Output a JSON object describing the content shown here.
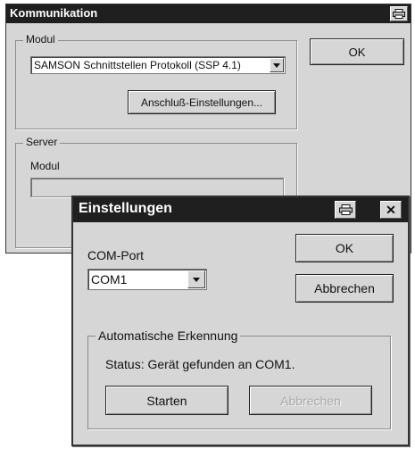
{
  "main_window": {
    "title": "Kommunikation",
    "icon": "printer-icon",
    "ok_label": "OK",
    "modul_group": {
      "legend": "Modul",
      "protocol_value": "SAMSON Schnittstellen Protokoll (SSP 4.1)",
      "settings_button": "Anschluß-Einstellungen..."
    },
    "server_group": {
      "legend": "Server",
      "modul_label": "Modul",
      "modul_value": ""
    }
  },
  "dialog": {
    "title": "Einstellungen",
    "icons": [
      "printer-icon",
      "close-icon"
    ],
    "close_glyph": "✕",
    "com_port_label": "COM-Port",
    "com_port_value": "COM1",
    "ok_label": "OK",
    "cancel_label": "Abbrechen",
    "auto_detect": {
      "legend": "Automatische Erkennung",
      "status_text": "Status: Gerät gefunden an COM1.",
      "start_button": "Starten",
      "abort_button": "Abbrechen",
      "abort_enabled": false
    }
  }
}
